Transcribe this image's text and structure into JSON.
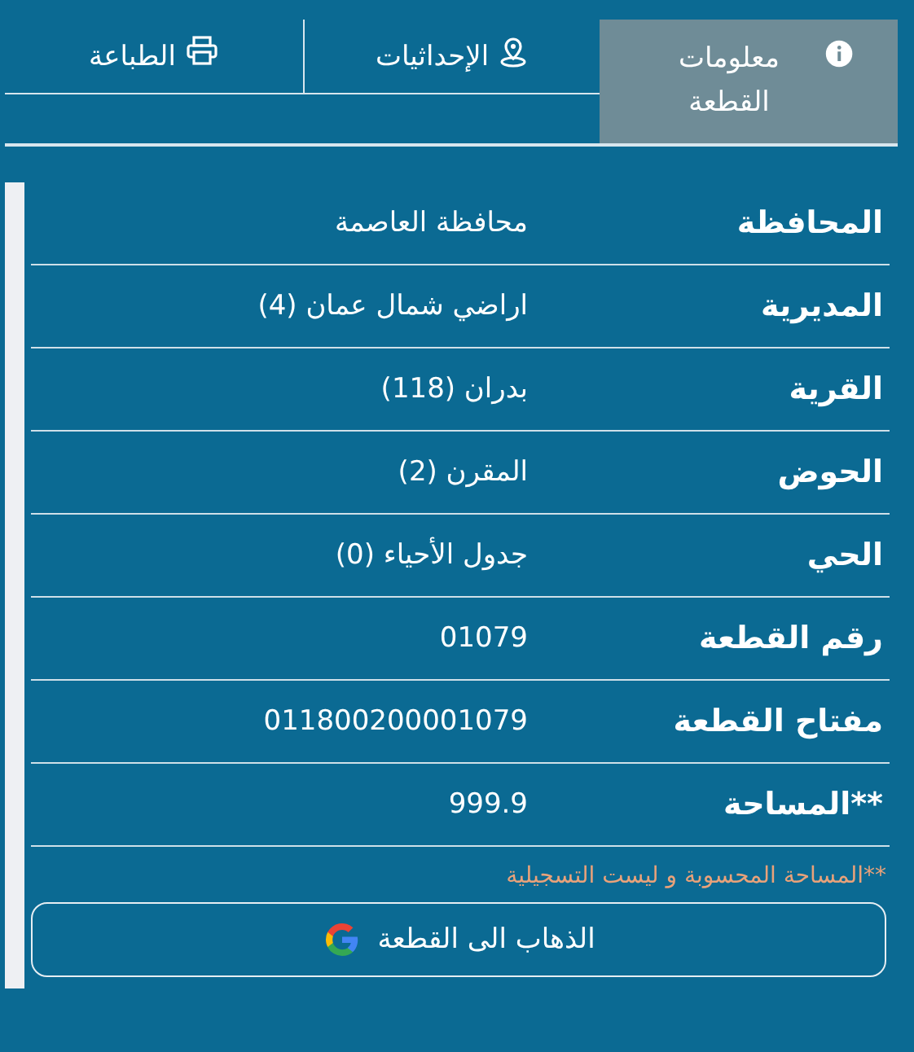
{
  "tabs": [
    {
      "label": "معلومات القطعة",
      "kind": "info",
      "selected": true
    },
    {
      "label": "الإحداثيات",
      "kind": "location",
      "selected": false
    },
    {
      "label": "الطباعة",
      "kind": "print",
      "selected": false
    }
  ],
  "details": [
    {
      "label": "المحافظة",
      "value": "محافظة العاصمة"
    },
    {
      "label": "المديرية",
      "value": "اراضي شمال عمان (4)"
    },
    {
      "label": "القرية",
      "value": "بدران (118)"
    },
    {
      "label": "الحوض",
      "value": "المقرن (2)"
    },
    {
      "label": "الحي",
      "value": "جدول الأحياء (0)"
    },
    {
      "label": "رقم القطعة",
      "value": "01079"
    },
    {
      "label": "مفتاح القطعة",
      "value": "011800200001079"
    },
    {
      "label": "**المساحة",
      "value": "999.9"
    }
  ],
  "note": "**المساحة المحسوبة و ليست التسجيلية",
  "map_button": "الذهاب الى القطعة"
}
